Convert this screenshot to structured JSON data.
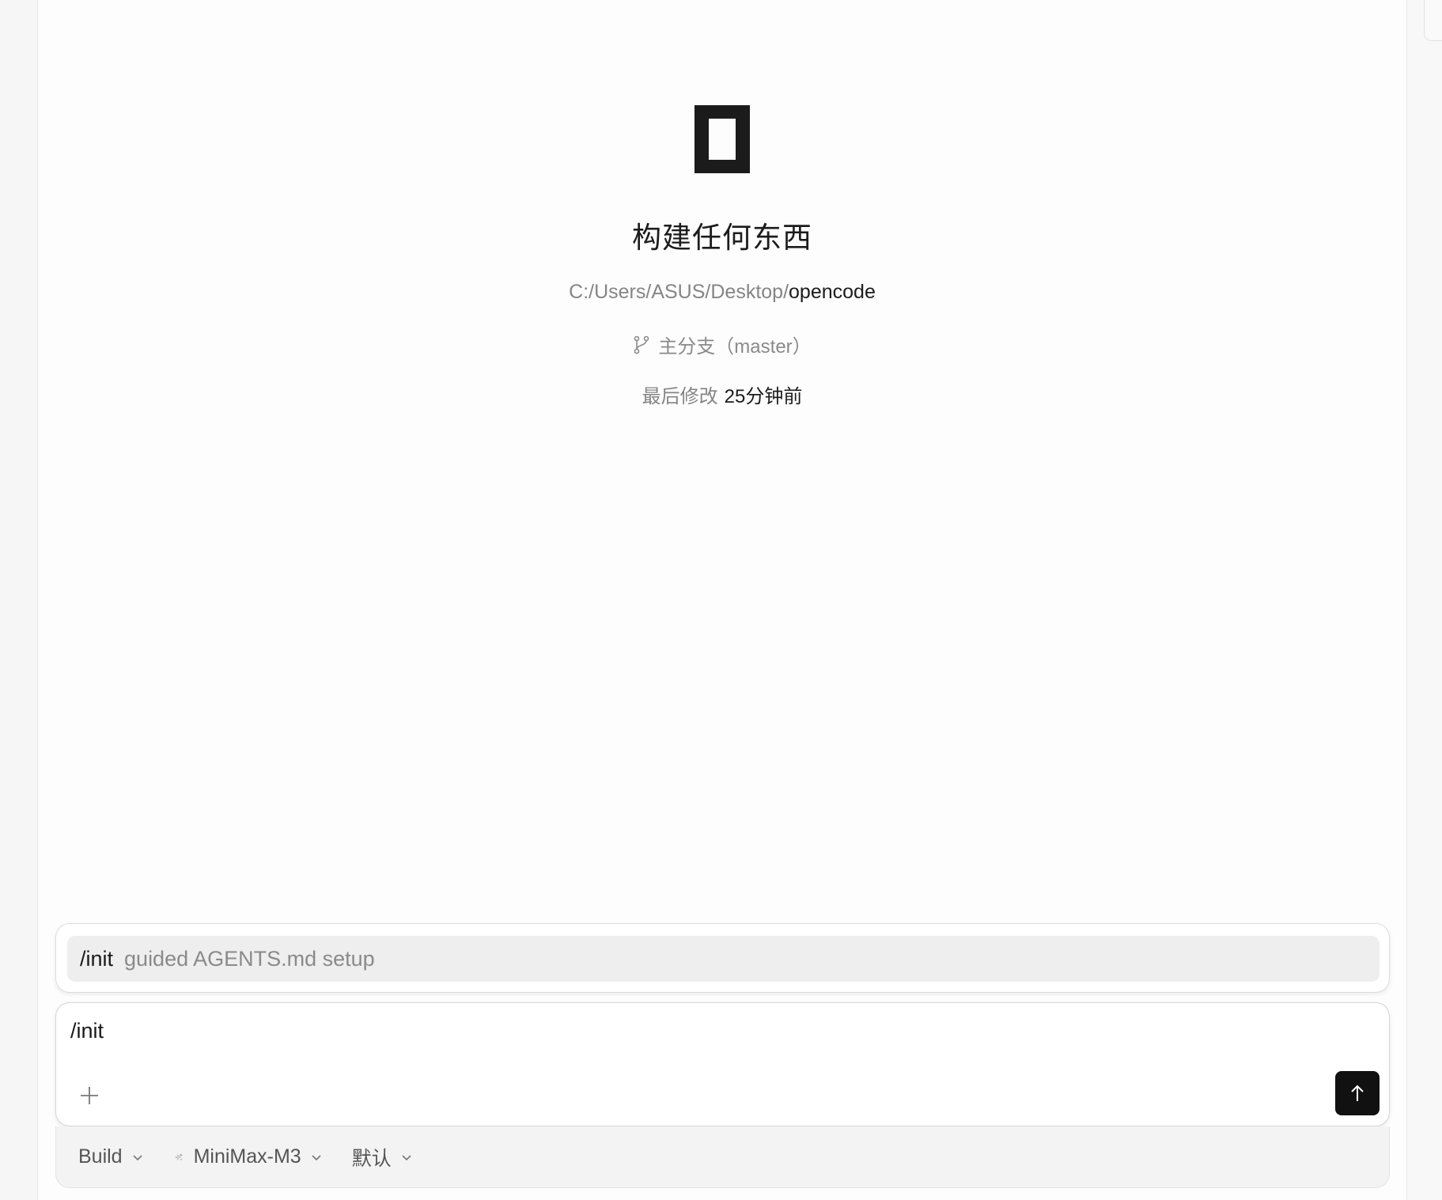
{
  "header": {
    "title": "构建任何东西",
    "path_prefix": "C:/Users/ASUS/Desktop/",
    "path_project": "opencode",
    "branch": "主分支（master）",
    "modified_label": "最后修改",
    "modified_value": "25分钟前"
  },
  "suggestion": {
    "command": "/init",
    "description": "guided AGENTS.md setup"
  },
  "composer": {
    "value": "/init"
  },
  "footer": {
    "agent": "Build",
    "model": "MiniMax-M3",
    "variant": "默认"
  },
  "icons": {
    "branch": "git-branch-icon",
    "add": "plus-icon",
    "send": "arrow-up-icon",
    "model": "sparkle-icon",
    "dropdown": "chevron-down-icon"
  },
  "colors": {
    "accent": "#111111",
    "muted_text": "#858585"
  }
}
